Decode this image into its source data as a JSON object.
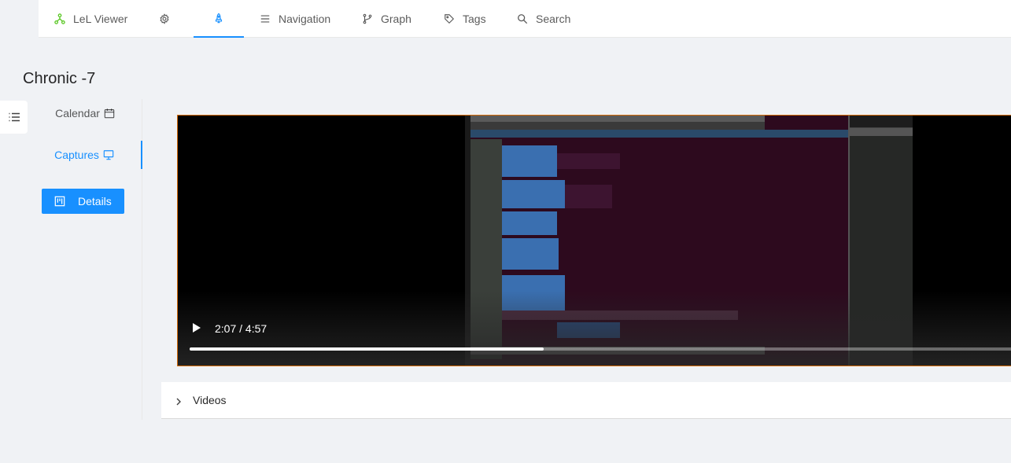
{
  "nav": {
    "brand": "LeL Viewer",
    "items": [
      {
        "label": "Navigation",
        "icon": "menu-icon"
      },
      {
        "label": "Graph",
        "icon": "branches-icon"
      },
      {
        "label": "Tags",
        "icon": "tag-icon"
      },
      {
        "label": "Search",
        "icon": "search-icon"
      }
    ],
    "accent_color": "#1890ff",
    "brand_color": "#52c41a"
  },
  "page": {
    "title": "Chronic -7"
  },
  "sidebar": {
    "items": [
      {
        "label": "Calendar",
        "icon": "calendar-icon"
      },
      {
        "label": "Captures",
        "icon": "desktop-icon"
      }
    ],
    "details_button": "Details"
  },
  "video": {
    "time_display": "2:07 / 4:57",
    "progress": 0.427
  },
  "collapse": {
    "label": "Videos"
  }
}
